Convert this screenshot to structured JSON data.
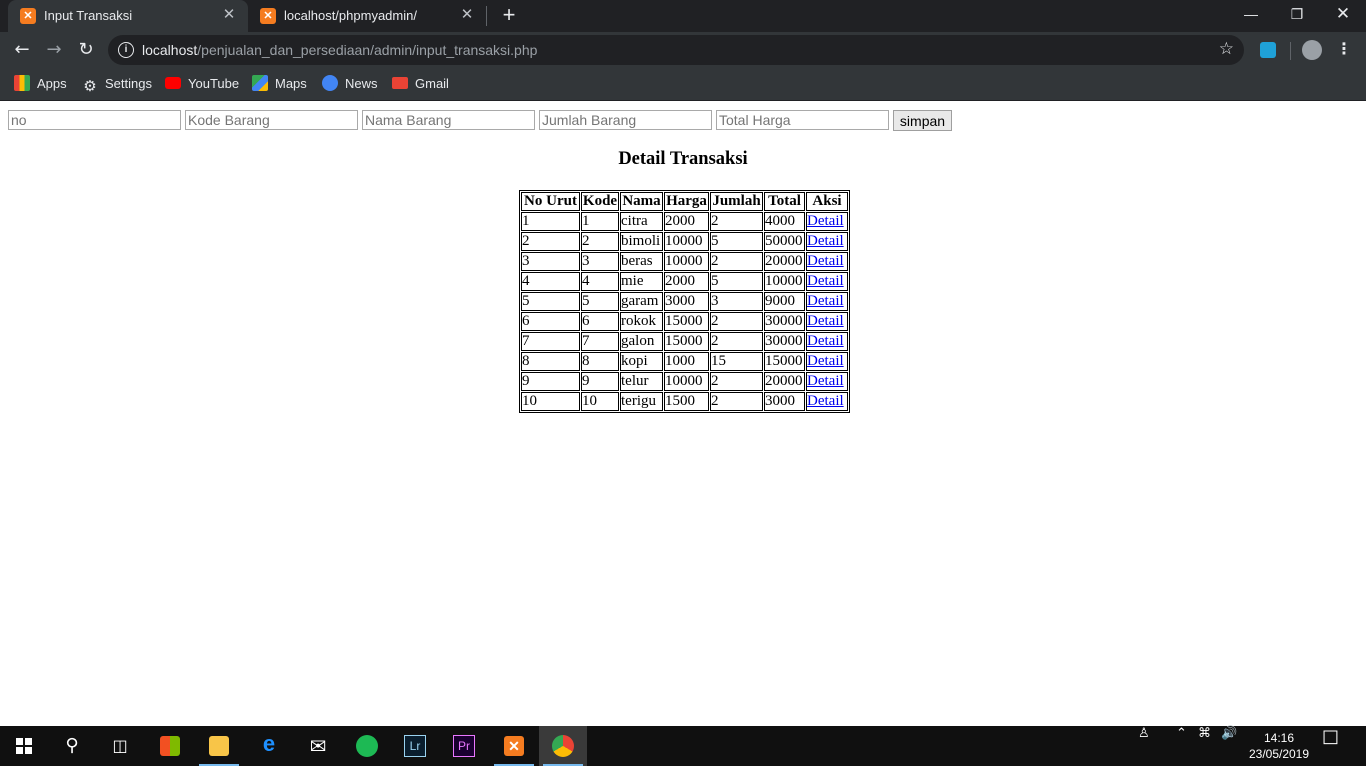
{
  "browser": {
    "tabs": [
      {
        "title": "Input Transaksi",
        "active": true
      },
      {
        "title": "localhost/phpmyadmin/",
        "active": false
      }
    ],
    "url_host": "localhost",
    "url_path": "/penjualan_dan_persediaan/admin/input_transaksi.php",
    "bookmarks": [
      {
        "label": "Apps",
        "icon": "apps-grid-icon"
      },
      {
        "label": "Settings",
        "icon": "gear-icon"
      },
      {
        "label": "YouTube",
        "icon": "youtube-icon"
      },
      {
        "label": "Maps",
        "icon": "maps-icon"
      },
      {
        "label": "News",
        "icon": "news-icon"
      },
      {
        "label": "Gmail",
        "icon": "gmail-icon"
      }
    ]
  },
  "form": {
    "placeholders": {
      "no": "no",
      "kode": "Kode Barang",
      "nama": "Nama Barang",
      "jumlah": "Jumlah Barang",
      "total": "Total Harga"
    },
    "submit_label": "simpan"
  },
  "heading": "Detail Transaksi",
  "table": {
    "headers": [
      "No Urut",
      "Kode",
      "Nama",
      "Harga",
      "Jumlah",
      "Total",
      "Aksi"
    ],
    "rows": [
      [
        "1",
        "1",
        "citra",
        "2000",
        "2",
        "4000",
        "Detail"
      ],
      [
        "2",
        "2",
        "bimoli",
        "10000",
        "5",
        "50000",
        "Detail"
      ],
      [
        "3",
        "3",
        "beras",
        "10000",
        "2",
        "20000",
        "Detail"
      ],
      [
        "4",
        "4",
        "mie",
        "2000",
        "5",
        "10000",
        "Detail"
      ],
      [
        "5",
        "5",
        "garam",
        "3000",
        "3",
        "9000",
        "Detail"
      ],
      [
        "6",
        "6",
        "rokok",
        "15000",
        "2",
        "30000",
        "Detail"
      ],
      [
        "7",
        "7",
        "galon",
        "15000",
        "2",
        "30000",
        "Detail"
      ],
      [
        "8",
        "8",
        "kopi",
        "1000",
        "15",
        "15000",
        "Detail"
      ],
      [
        "9",
        "9",
        "telur",
        "10000",
        "2",
        "20000",
        "Detail"
      ],
      [
        "10",
        "10",
        "terigu",
        "1500",
        "2",
        "3000",
        "Detail"
      ]
    ]
  },
  "taskbar": {
    "time": "14:16",
    "date": "23/05/2019"
  },
  "colors": {
    "link": "#0000ee",
    "chrome_dark": "#202124",
    "chrome_toolbar": "#323639",
    "taskbar": "#101010",
    "xampp_orange": "#f57c20"
  }
}
